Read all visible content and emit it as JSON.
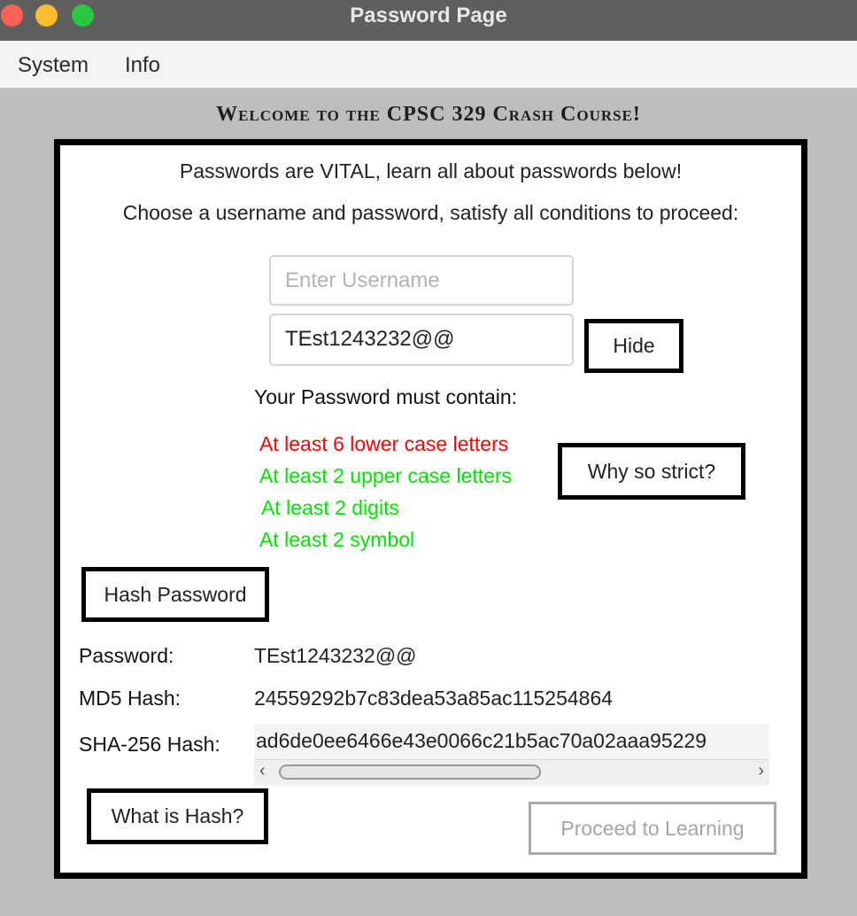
{
  "window": {
    "title": "Password Page"
  },
  "menu": {
    "items": [
      "System",
      "Info"
    ]
  },
  "welcome": "Welcome to the CPSC 329 Crash Course!",
  "intro": {
    "line1": "Passwords are VITAL, learn all about passwords below!",
    "line2": "Choose a username and password, satisfy all conditions to proceed:"
  },
  "form": {
    "username_placeholder": "Enter Username",
    "username_value": "",
    "password_value": "TEst1243232@@",
    "hide_label": "Hide"
  },
  "requirements": {
    "heading": "Your Password must contain:",
    "items": [
      {
        "text": "At least 6 lower case letters",
        "met": false,
        "color": "#ff0000"
      },
      {
        "text": "At least 2 upper case letters",
        "met": true,
        "color": "#00e400"
      },
      {
        "text": "At least 2 digits",
        "met": true,
        "color": "#00e400"
      },
      {
        "text": "At least 2 symbol",
        "met": true,
        "color": "#00e400"
      }
    ],
    "why_label": "Why so strict?"
  },
  "hashing": {
    "button_label": "Hash Password",
    "password_label": "Password:",
    "password_value": "TEst1243232@@",
    "md5_label": "MD5 Hash:",
    "md5_value": "24559292b7c83dea53a85ac115254864",
    "sha256_label": "SHA-256 Hash:",
    "sha256_value": "ad6de0ee6466e43e0066c21b5ac70a02aaa95229"
  },
  "footer": {
    "what_is_hash_label": "What is Hash?",
    "proceed_label": "Proceed to Learning"
  }
}
